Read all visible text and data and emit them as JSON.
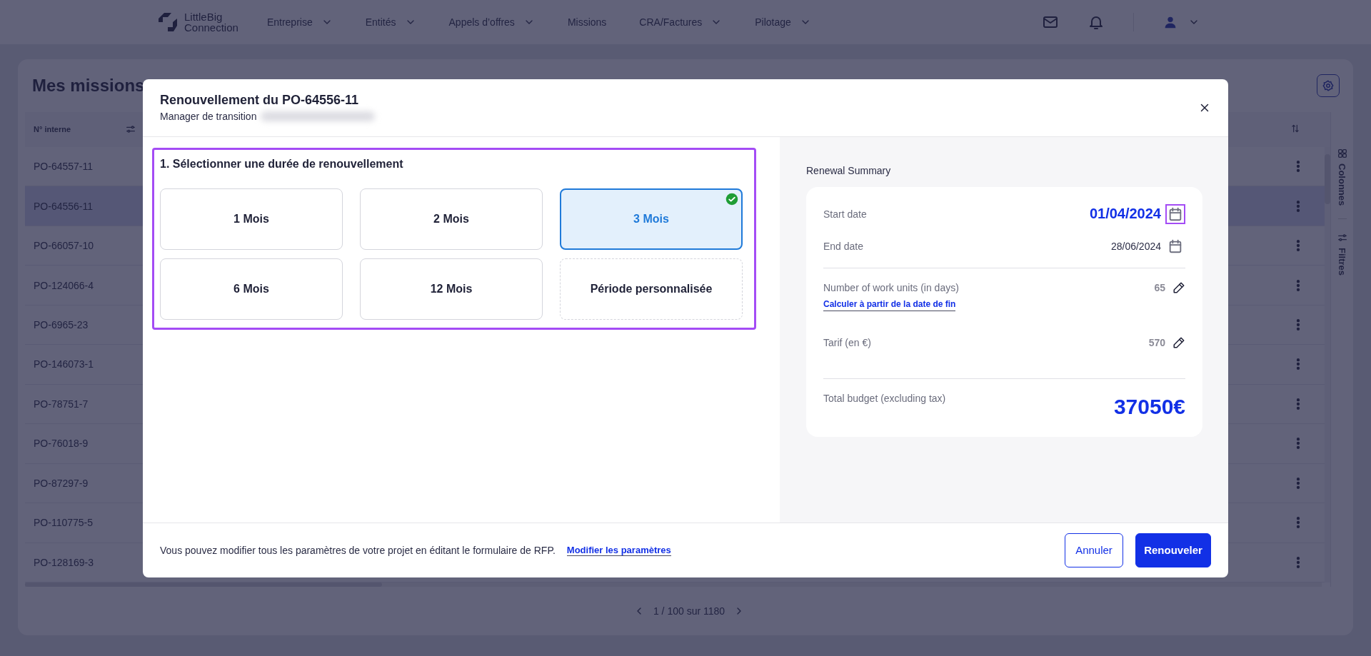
{
  "header": {
    "logo": {
      "line1": "LittleBig",
      "line2": "Connection"
    },
    "nav": [
      {
        "label": "Entreprise",
        "dropdown": true
      },
      {
        "label": "Entités",
        "dropdown": true
      },
      {
        "label": "Appels d’offres",
        "dropdown": true
      },
      {
        "label": "Missions",
        "dropdown": false
      },
      {
        "label": "CRA/Factures",
        "dropdown": true
      },
      {
        "label": "Pilotage",
        "dropdown": true
      }
    ]
  },
  "page": {
    "title": "Mes missions",
    "column_1": "N° interne",
    "rows": [
      {
        "id": "PO-64557-11",
        "selected": false
      },
      {
        "id": "PO-64556-11",
        "selected": true
      },
      {
        "id": "PO-66057-10",
        "selected": false
      },
      {
        "id": "PO-124066-4",
        "selected": false
      },
      {
        "id": "PO-6965-23",
        "selected": false
      },
      {
        "id": "PO-146073-1",
        "selected": false
      },
      {
        "id": "PO-78751-7",
        "selected": false
      },
      {
        "id": "PO-76018-9",
        "selected": false
      },
      {
        "id": "PO-87297-9",
        "selected": false
      },
      {
        "id": "PO-110775-5",
        "selected": false
      },
      {
        "id": "PO-128169-3",
        "selected": false
      }
    ],
    "side_tabs": [
      {
        "label": "Colonnes",
        "kind": "columns"
      },
      {
        "label": "Filtres",
        "kind": "filters"
      }
    ],
    "pagination": "1 / 100 sur 1180"
  },
  "modal": {
    "title": "Renouvellement du PO-64556-11",
    "subtitle": "Manager de transition",
    "step": {
      "title": "1. Sélectionner une durée de renouvellement",
      "highlighted": true
    },
    "options": [
      {
        "label": "1 Mois",
        "kind": "preset",
        "selected": false
      },
      {
        "label": "2 Mois",
        "kind": "preset",
        "selected": false
      },
      {
        "label": "3 Mois",
        "kind": "preset",
        "selected": true
      },
      {
        "label": "6 Mois",
        "kind": "preset",
        "selected": false
      },
      {
        "label": "12 Mois",
        "kind": "preset",
        "selected": false
      },
      {
        "label": "Période personnalisée",
        "kind": "custom",
        "selected": false
      }
    ],
    "summary": {
      "title": "Renewal Summary",
      "dates": [
        {
          "label": "Start date",
          "value": "01/04/2024",
          "emphasized": true,
          "highlighted": true
        },
        {
          "label": "End date",
          "value": "28/06/2024",
          "emphasized": false,
          "highlighted": false
        }
      ],
      "units": {
        "label": "Number of work units (in days)",
        "value": "65",
        "link": "Calculer à partir de la date de fin"
      },
      "rate": {
        "label": "Tarif (en €)",
        "value": "570"
      },
      "total": {
        "label": "Total budget (excluding tax)",
        "value": "37050€"
      }
    },
    "footer": {
      "note": "Vous pouvez modifier tous les paramètres de votre projet en éditant le formulaire de RFP.",
      "link": "Modifier les paramètres",
      "buttons": [
        {
          "label": "Annuler",
          "kind": "secondary"
        },
        {
          "label": "Renouveler",
          "kind": "primary"
        }
      ]
    }
  }
}
